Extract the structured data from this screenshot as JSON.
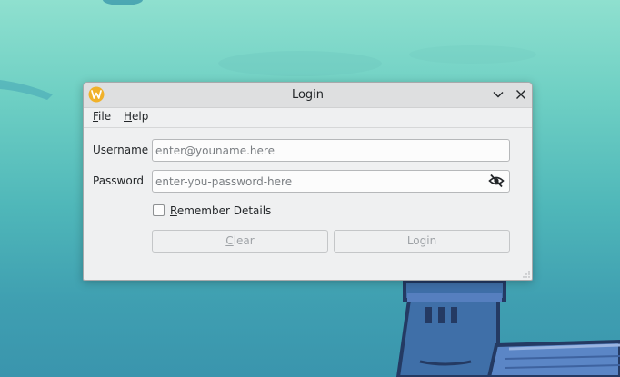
{
  "window": {
    "title": "Login"
  },
  "menu": {
    "file": {
      "label_mnemonic": "F",
      "label_rest": "ile"
    },
    "help": {
      "label_mnemonic": "H",
      "label_rest": "elp"
    }
  },
  "form": {
    "username_label": "Username",
    "username_placeholder": "enter@youname.here",
    "username_value": "",
    "password_label": "Password",
    "password_placeholder": "enter-you-password-here",
    "password_value": "",
    "remember": {
      "label_mnemonic": "R",
      "label_rest": "emember Details",
      "checked": false
    }
  },
  "buttons": {
    "clear": {
      "label_mnemonic": "C",
      "label_rest": "lear"
    },
    "login": {
      "label": "Login"
    }
  },
  "icons": {
    "app": "app-logo-icon",
    "minimize": "chevron-down-icon",
    "close": "close-icon",
    "password_toggle": "eye-off-icon"
  },
  "colors": {
    "app_icon": "#f0b12a",
    "window_bg": "#eff0f1",
    "titlebar_bg": "#dedfe0",
    "disabled_text": "#9ea2a6"
  }
}
